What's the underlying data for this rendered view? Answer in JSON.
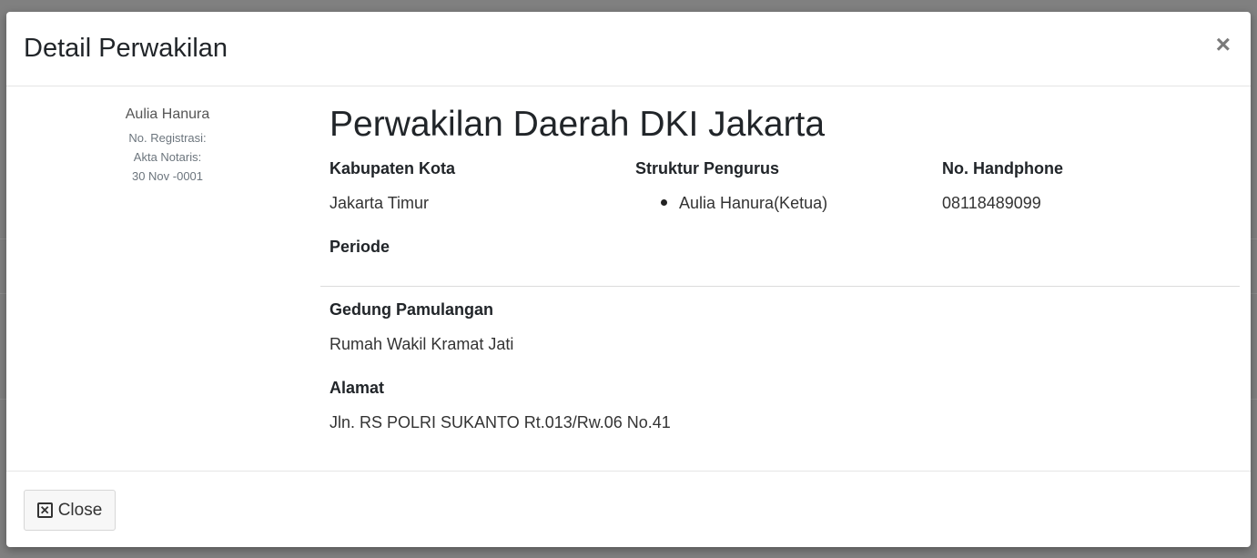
{
  "modal": {
    "title": "Detail Perwakilan",
    "close_symbol": "×"
  },
  "profile": {
    "name": "Aulia Hanura",
    "registration": "No. Registrasi:",
    "notary": "Akta Notaris:",
    "date": "30 Nov -0001"
  },
  "detail": {
    "heading": "Perwakilan Daerah DKI Jakarta",
    "kabupaten_label": "Kabupaten Kota",
    "kabupaten_value": "Jakarta Timur",
    "struktur_label": "Struktur Pengurus",
    "struktur_items": [
      "Aulia Hanura(Ketua)"
    ],
    "handphone_label": "No. Handphone",
    "handphone_value": "08118489099",
    "periode_label": "Periode",
    "gedung_label": "Gedung Pamulangan",
    "gedung_value": "Rumah Wakil Kramat Jati",
    "alamat_label": "Alamat",
    "alamat_value": "Jln. RS POLRI SUKANTO Rt.013/Rw.06 No.41"
  },
  "footer": {
    "close_label": "Close",
    "close_icon": "close-box-icon"
  }
}
